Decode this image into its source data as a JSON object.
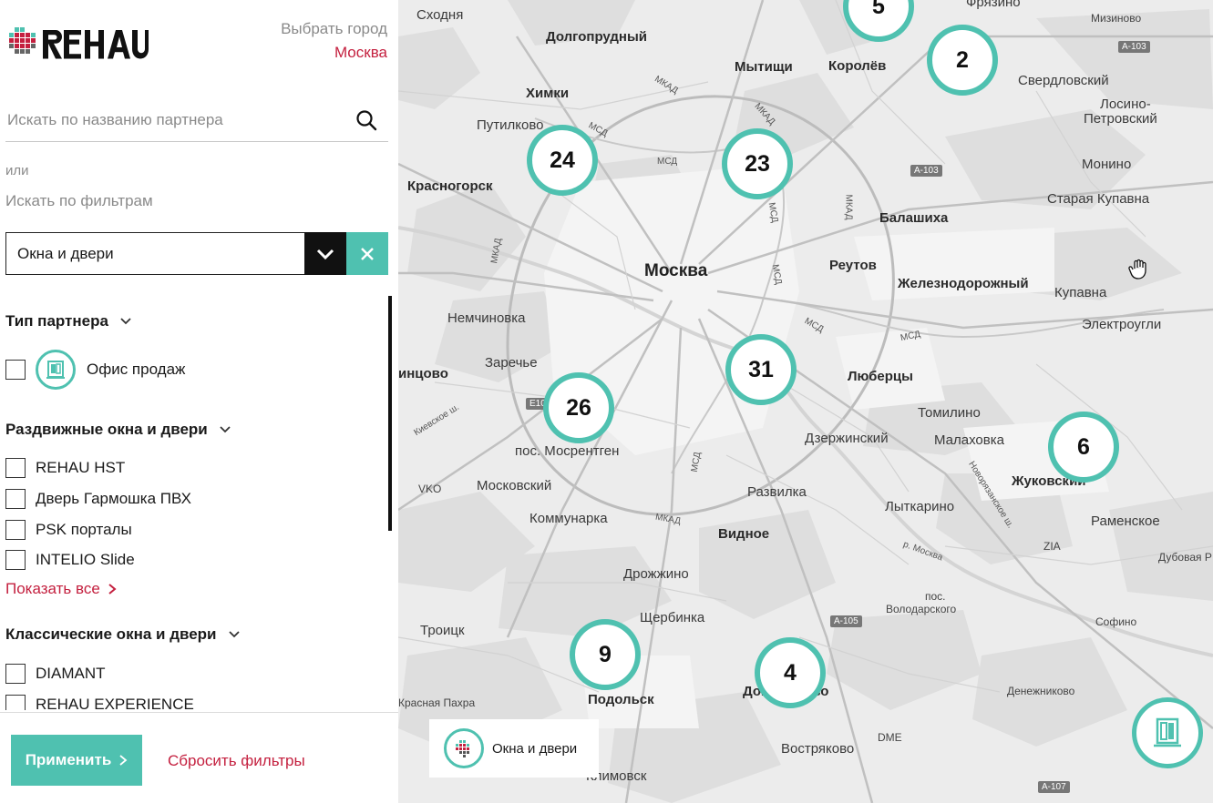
{
  "brand": {
    "logo_text": "REHAU",
    "accent": "#4fc1b0",
    "link_color": "#c4203f"
  },
  "city": {
    "label": "Выбрать город",
    "value": "Москва"
  },
  "search": {
    "placeholder": "Искать по названию партнера",
    "icon": "search-icon"
  },
  "or_label": "или",
  "filter_label": "Искать по фильтрам",
  "category_select": {
    "value": "Окна и двери"
  },
  "groups": [
    {
      "title": "Тип партнера",
      "items": [
        "Офис продаж"
      ]
    },
    {
      "title": "Раздвижные окна и двери",
      "items": [
        "REHAU HST",
        "Дверь Гармошка ПВХ",
        "PSK порталы",
        "INTELIO Slide"
      ],
      "show_all": "Показать все"
    },
    {
      "title": "Классические окна и двери",
      "items": [
        "DIAMANT",
        "REHAU EXPERIENCE"
      ]
    }
  ],
  "buttons": {
    "apply": "Применить",
    "reset": "Сбросить фильтры"
  },
  "map": {
    "clusters": [
      "5",
      "2",
      "24",
      "23",
      "31",
      "26",
      "6",
      "9",
      "4"
    ],
    "legend": "Окна и двери",
    "places": {
      "skhodnya": "Сходня",
      "dolgoprudny": "Долгопрудный",
      "mytishchi": "Мытищи",
      "korolev": "Королёв",
      "fryazino": "Фрязино",
      "mizinovo": "Мизиново",
      "khimki": "Химки",
      "sverdlovsky": "Свердловский",
      "losino1": "Лосино-",
      "losino2": "Петровский",
      "putilkovo": "Путилково",
      "monino": "Монино",
      "krasnogorsk": "Красногорск",
      "staraya_kupavna": "Старая Купавна",
      "balashikha": "Балашиха",
      "moskva": "Москва",
      "reutov": "Реутов",
      "zheleznodorozhny": "Железнодорожный",
      "kupavna": "Купавна",
      "nemchinovka": "Немчиновка",
      "elektrougli": "Электроугли",
      "zarechye": "Заречье",
      "intsovo": "инцово",
      "lyubertsy": "Люберцы",
      "tomilino": "Томилино",
      "mosrentgen": "пос. Мосрентген",
      "dzerzhinsky": "Дзержинский",
      "malakhovka": "Малаховка",
      "zhukovsky": "Жуковский",
      "moskovsky": "Московский",
      "razvilka": "Развилка",
      "lytkarino": "Лыткарино",
      "kommunarka": "Коммунарка",
      "vidnoe": "Видное",
      "ramenskoe": "Раменское",
      "drozhzhino": "Дрожжино",
      "volodarsky1": "пос.",
      "volodarsky2": "Володарского",
      "troitsk": "Троицк",
      "shcherbinka": "Щербинка",
      "sofino": "Софино",
      "dubovaya": "Дубовая Р",
      "krasnaya_pakhra": "Красная Пахра",
      "podolsk": "Подольск",
      "domodedovo": "Домодедово",
      "denezhnikovo": "Денежниково",
      "vostryakovo": "Востряково",
      "klimovsk": "Климовск",
      "vnukovo": "VKO",
      "domodedovo_air": "DME",
      "zhukovsky_air": "ZIA"
    },
    "roads": [
      "МКАД",
      "МСД",
      "A-103",
      "A-105",
      "A-107",
      "E101",
      "Киевское ш.",
      "Новорязанское ш.",
      "р. Москва"
    ]
  }
}
